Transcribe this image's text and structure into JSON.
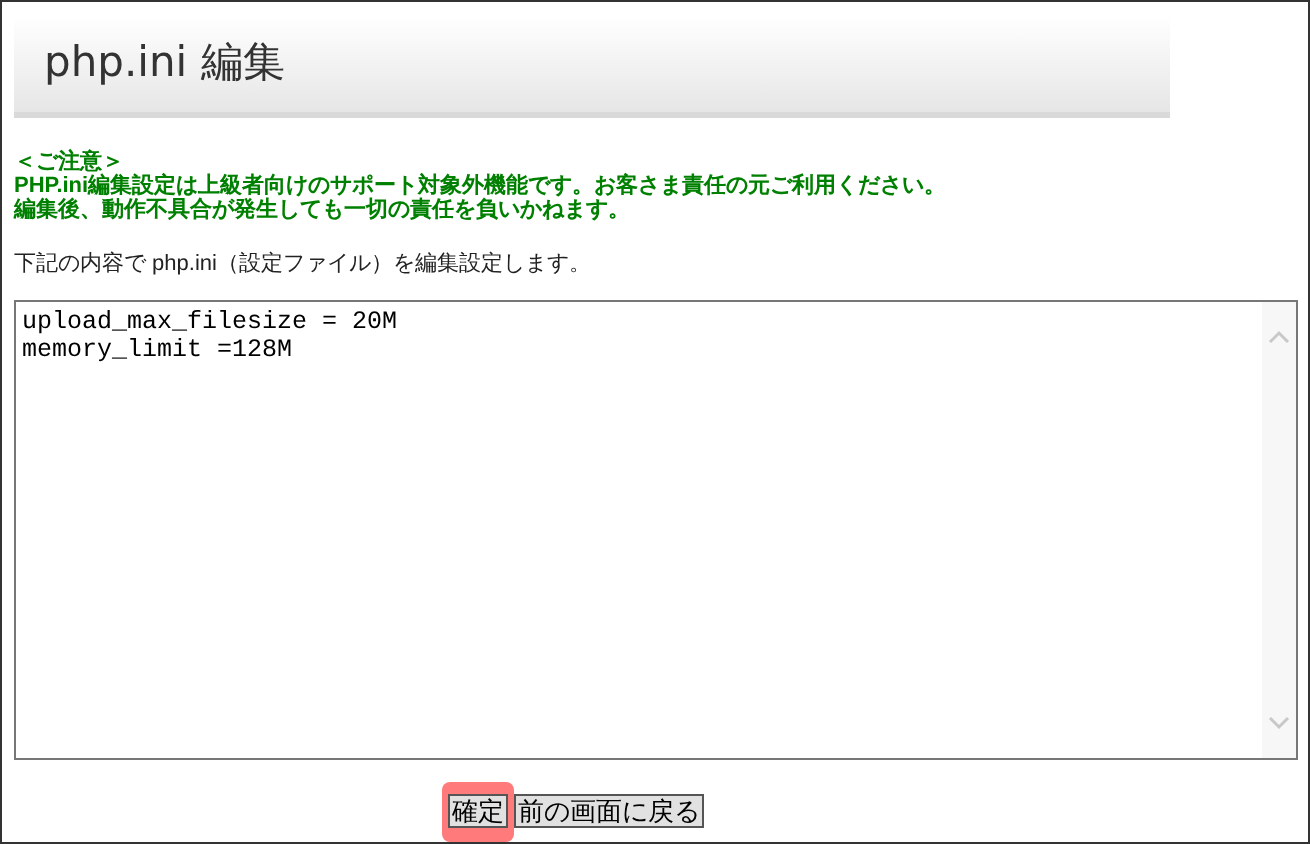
{
  "title": "php.ini 編集",
  "notice": [
    "＜ご注意＞",
    "PHP.ini編集設定は上級者向けのサポート対象外機能です。お客さま責任の元ご利用ください。",
    "編集後、動作不具合が発生しても一切の責任を負いかねます。"
  ],
  "description": "下記の内容で php.ini（設定ファイル）を編集設定します。",
  "editor": {
    "lines": [
      "upload_max_filesize = 20M",
      "memory_limit =128M"
    ]
  },
  "buttons": [
    {
      "label": "確定",
      "highlighted": true
    },
    {
      "label": "前の画面に戻る",
      "highlighted": false
    }
  ]
}
